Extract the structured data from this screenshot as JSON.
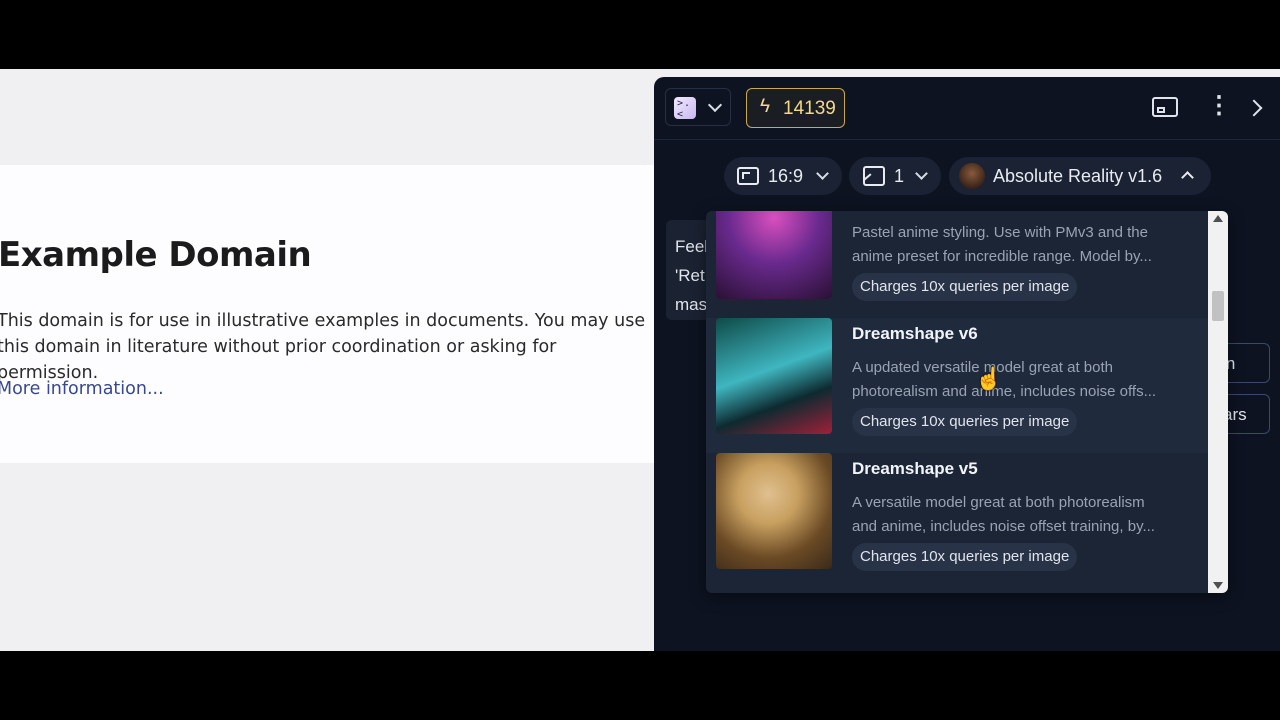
{
  "page": {
    "title": "Example Domain",
    "paragraph": "This domain is for use in illustrative examples in documents. You may use this domain in literature without prior coordination or asking for permission.",
    "link": "More information..."
  },
  "panel": {
    "logo_icon": "app-logo",
    "credits": "14139",
    "controls": {
      "aspect_ratio": "16:9",
      "image_count": "1",
      "model": "Absolute Reality v1.6"
    },
    "side_text": [
      "Feel",
      "'Ret",
      "mas"
    ],
    "side_buttons": [
      "oon",
      "ars"
    ],
    "models": [
      {
        "title": "",
        "desc_lines": [
          "Pastel anime styling. Use with PMv3 and the",
          "anime preset for incredible range. Model by..."
        ],
        "badge": "Charges 10x queries per image",
        "thumb_colors": [
          "#2a1033",
          "#d94fbf",
          "#6a2a8f"
        ]
      },
      {
        "title": "Dreamshape v6",
        "desc_lines": [
          "A updated versatile model great at both",
          "photorealism and anime, includes noise offs..."
        ],
        "badge": "Charges 10x queries per image",
        "thumb_colors": [
          "#0f4a48",
          "#3fb6c0",
          "#a0203a"
        ]
      },
      {
        "title": "Dreamshape v5",
        "desc_lines": [
          "A versatile model great at both photorealism",
          "and anime, includes noise offset training, by..."
        ],
        "badge": "Charges 10x queries per image",
        "thumb_colors": [
          "#3a2a1a",
          "#c8a060",
          "#6b4a25"
        ]
      }
    ]
  },
  "colors": {
    "panel_bg": "#0d1321",
    "dropdown_bg": "#1c2535",
    "credits_accent": "#c9a94e"
  }
}
